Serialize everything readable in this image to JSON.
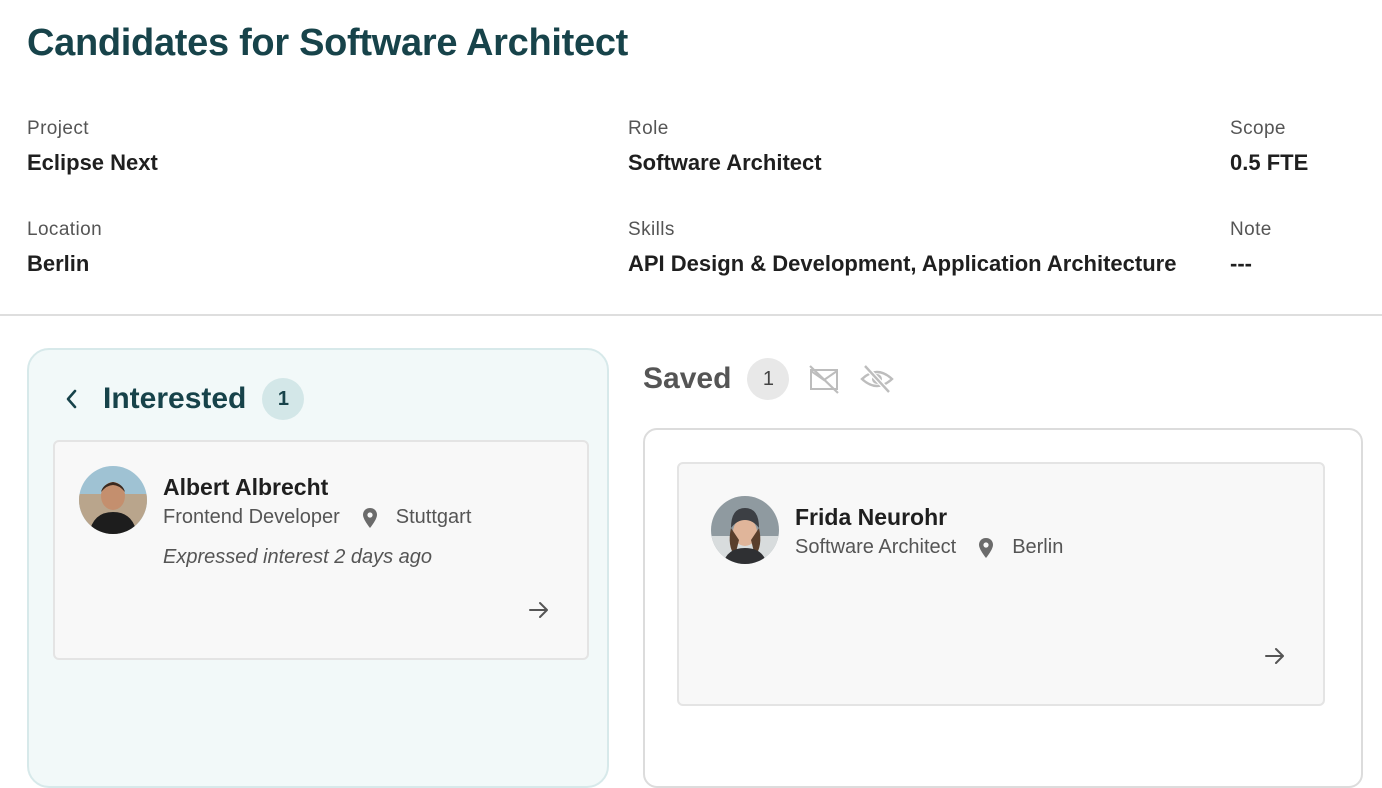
{
  "page": {
    "title": "Candidates for Software Architect"
  },
  "details": {
    "project": {
      "label": "Project",
      "value": "Eclipse Next"
    },
    "role": {
      "label": "Role",
      "value": "Software Architect"
    },
    "scope": {
      "label": "Scope",
      "value": "0.5 FTE"
    },
    "location": {
      "label": "Location",
      "value": "Berlin"
    },
    "skills": {
      "label": "Skills",
      "value": "API Design & Development, Application Architecture"
    },
    "note": {
      "label": "Note",
      "value": "---"
    }
  },
  "interested": {
    "title": "Interested",
    "count": "1",
    "icons": {
      "back": "chevron-left-icon"
    },
    "candidates": [
      {
        "name": "Albert Albrecht",
        "role": "Frontend Developer",
        "location": "Stuttgart",
        "note": "Expressed interest 2 days ago"
      }
    ]
  },
  "saved": {
    "title": "Saved",
    "count": "1",
    "icons": {
      "mail_off": "mail-off-icon",
      "hidden": "eye-off-icon"
    },
    "candidates": [
      {
        "name": "Frida Neurohr",
        "role": "Software Architect",
        "location": "Berlin"
      }
    ]
  },
  "colors": {
    "title": "#17434a",
    "interested_bg": "#f2f9f9",
    "interested_border": "#d7e9ea",
    "card_bg": "#f8f8f8",
    "badge_teal": "#d3e7e8"
  }
}
